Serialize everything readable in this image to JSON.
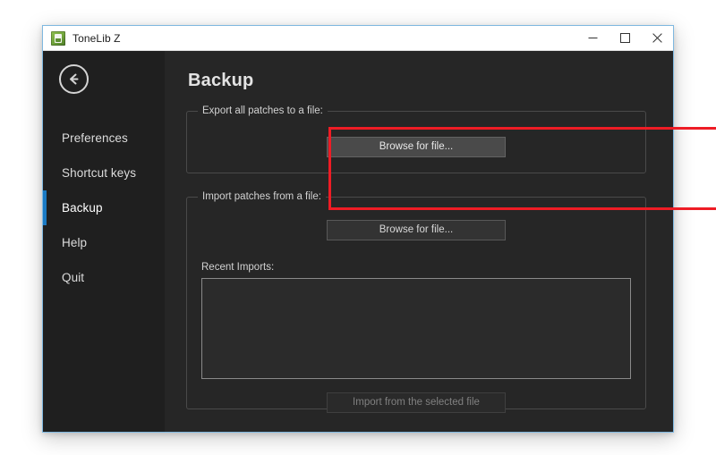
{
  "window": {
    "title": "ToneLib Z",
    "app_icon": "tonelib-app-icon",
    "accent_border_color": "#7fb8e0",
    "controls": {
      "minimize": "minimize-icon",
      "maximize": "maximize-icon",
      "close": "close-icon"
    }
  },
  "sidebar": {
    "back_button": "back-arrow-icon",
    "active_indicator_color": "#1a7ac4",
    "items": [
      {
        "label": "Preferences",
        "active": false
      },
      {
        "label": "Shortcut keys",
        "active": false
      },
      {
        "label": "Backup",
        "active": true
      },
      {
        "label": "Help",
        "active": false
      },
      {
        "label": "Quit",
        "active": false
      }
    ]
  },
  "main": {
    "page_title": "Backup",
    "export_group": {
      "legend": "Export all patches to a file:",
      "browse_button": "Browse for file...",
      "browse_button_state": "hover"
    },
    "import_group": {
      "legend": "Import patches from a file:",
      "browse_button": "Browse for file...",
      "browse_button_state": "normal",
      "recent_imports_label": "Recent Imports:",
      "recent_imports_items": [],
      "import_button": "Import from the selected file",
      "import_button_state": "disabled"
    }
  },
  "annotation": {
    "highlight_color": "#ee1c25",
    "target": "export-all-patches-group"
  }
}
